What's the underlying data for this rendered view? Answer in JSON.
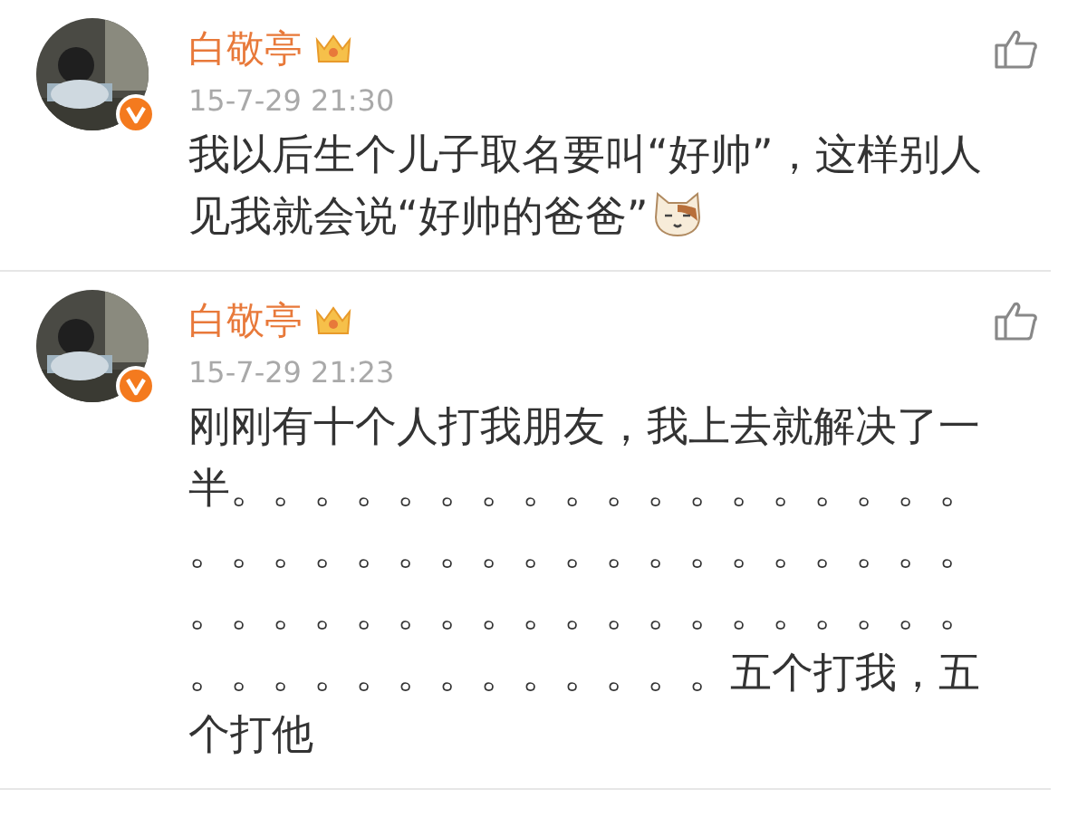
{
  "comments": [
    {
      "author": "白敬亭",
      "vip": true,
      "verified": true,
      "time": "15-7-29 21:30",
      "text": "我以后生个儿子取名要叫“好帅”，这样别人见我就会说“好帅的爸爸”",
      "emoji": true
    },
    {
      "author": "白敬亭",
      "vip": true,
      "verified": true,
      "time": "15-7-29 21:23",
      "text": "刚刚有十个人打我朋友，我上去就解决了一半。。。。。。。。。。。。。。。。。。。。。。。。。。。。。。。。。。。。。。。。。。。。。。。。。。。。。。。。。。。。。。。。。。。。。五个打我，五个打他",
      "emoji": false
    }
  ]
}
